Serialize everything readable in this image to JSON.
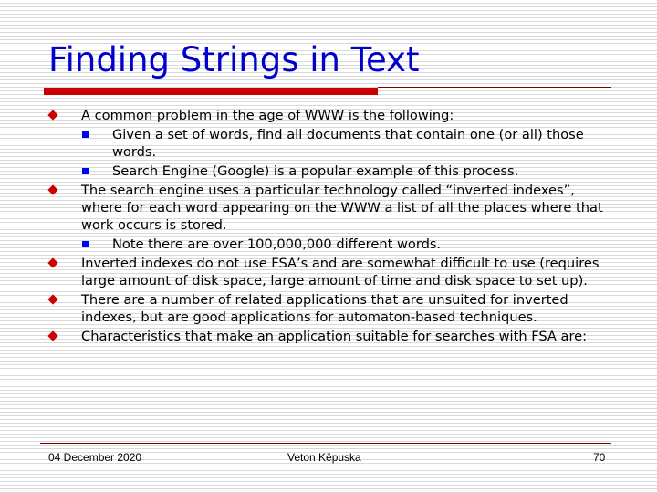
{
  "slide": {
    "title": "Finding Strings in Text",
    "colors": {
      "title": "#0000cc",
      "accent_bar": "#cc0000",
      "level1_bullet": "#cc0000",
      "level2_bullet": "#0000ff"
    },
    "bullets": [
      {
        "text": "A common problem in the age of WWW is the following:",
        "sub": [
          "Given a set of words, find all documents that contain one (or all) those words.",
          "Search Engine (Google) is a popular example of this process."
        ]
      },
      {
        "text": "The search engine uses a particular technology called “inverted indexes”, where for each word appearing on the WWW a list of all the places where that work occurs is stored.",
        "sub": [
          "Note there are over 100,000,000 different words."
        ]
      },
      {
        "text": "Inverted indexes do not use FSA’s and are somewhat difficult to use (requires large amount of disk space, large amount of time and disk space to set up).",
        "sub": []
      },
      {
        "text": "There are a number of related applications that are unsuited for inverted indexes, but are good applications for automaton-based techniques.",
        "sub": []
      },
      {
        "text": "Characteristics that make an application suitable for searches with FSA are:",
        "sub": []
      }
    ]
  },
  "footer": {
    "date": "04 December 2020",
    "author": "Veton Këpuska",
    "page": "70"
  }
}
